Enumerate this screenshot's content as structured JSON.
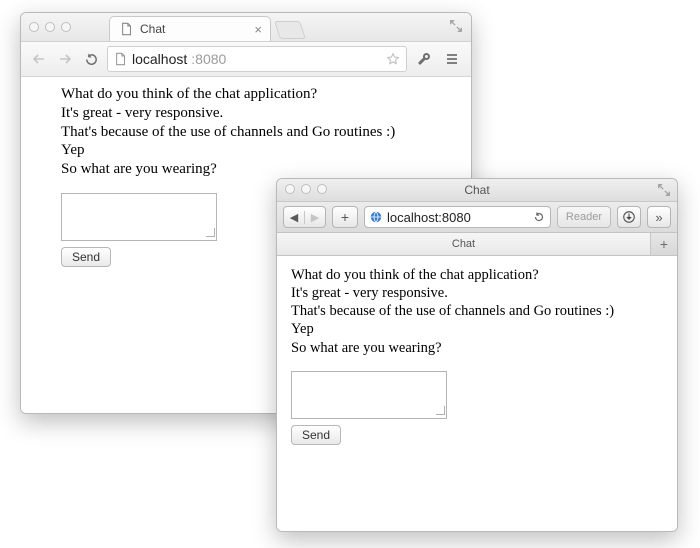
{
  "chrome": {
    "tab_title": "Chat",
    "url_host": "localhost",
    "url_port": ":8080"
  },
  "safari": {
    "window_title": "Chat",
    "tab_title": "Chat",
    "url": "localhost:8080",
    "reader_label": "Reader"
  },
  "chat": {
    "messages": [
      "What do you think of the chat application?",
      "It's great - very responsive.",
      "That's because of the use of channels and Go routines :)",
      "Yep",
      "So what are you wearing?"
    ],
    "send_label": "Send"
  }
}
